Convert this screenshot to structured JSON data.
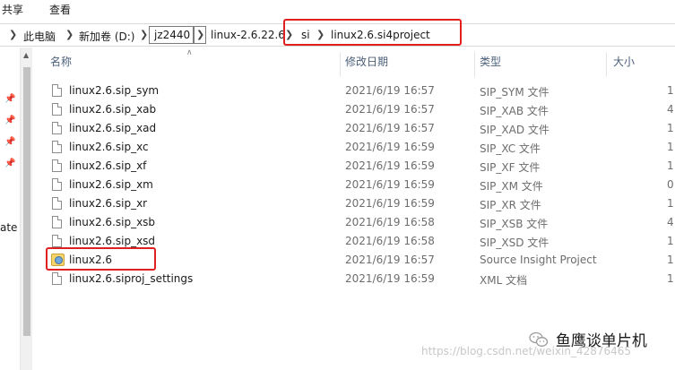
{
  "ribbon": {
    "tabs": [
      "共享",
      "查看"
    ]
  },
  "breadcrumb": {
    "items": [
      "此电脑",
      "新加卷 (D:)",
      "jz2440",
      "linux-2.6.22.6",
      "si",
      "linux2.6.si4project"
    ]
  },
  "columns": {
    "name": "名称",
    "date": "修改日期",
    "type": "类型",
    "size": "大小"
  },
  "left_pane": {
    "cut_label": "ate"
  },
  "files": [
    {
      "name": "linux2.6.sip_sym",
      "date": "2021/6/19 16:57",
      "type": "SIP_SYM 文件",
      "size": "1",
      "icon": "file-icon"
    },
    {
      "name": "linux2.6.sip_xab",
      "date": "2021/6/19 16:57",
      "type": "SIP_XAB 文件",
      "size": "4",
      "icon": "file-icon"
    },
    {
      "name": "linux2.6.sip_xad",
      "date": "2021/6/19 16:57",
      "type": "SIP_XAD 文件",
      "size": "1",
      "icon": "file-icon"
    },
    {
      "name": "linux2.6.sip_xc",
      "date": "2021/6/19 16:59",
      "type": "SIP_XC 文件",
      "size": "1",
      "icon": "file-icon"
    },
    {
      "name": "linux2.6.sip_xf",
      "date": "2021/6/19 16:59",
      "type": "SIP_XF 文件",
      "size": "1",
      "icon": "file-icon"
    },
    {
      "name": "linux2.6.sip_xm",
      "date": "2021/6/19 16:59",
      "type": "SIP_XM 文件",
      "size": "0",
      "icon": "file-icon"
    },
    {
      "name": "linux2.6.sip_xr",
      "date": "2021/6/19 16:59",
      "type": "SIP_XR 文件",
      "size": "1",
      "icon": "file-icon"
    },
    {
      "name": "linux2.6.sip_xsb",
      "date": "2021/6/19 16:58",
      "type": "SIP_XSB 文件",
      "size": "4",
      "icon": "file-icon"
    },
    {
      "name": "linux2.6.sip_xsd",
      "date": "2021/6/19 16:58",
      "type": "SIP_XSD 文件",
      "size": "1",
      "icon": "file-icon"
    },
    {
      "name": "linux2.6",
      "date": "2021/6/19 16:57",
      "type": "Source Insight Project",
      "size": "1",
      "icon": "source-insight-project-icon"
    },
    {
      "name": "linux2.6.siproj_settings",
      "date": "2021/6/19 16:59",
      "type": "XML 文档",
      "size": "1",
      "icon": "file-icon"
    }
  ],
  "watermark": "https://blog.csdn.net/weixin_42876465",
  "wechat_label": "鱼鹰谈单片机",
  "colors": {
    "highlight_box": "#e02020",
    "column_header": "#4c607a",
    "detail_text": "#6d6d6d"
  }
}
